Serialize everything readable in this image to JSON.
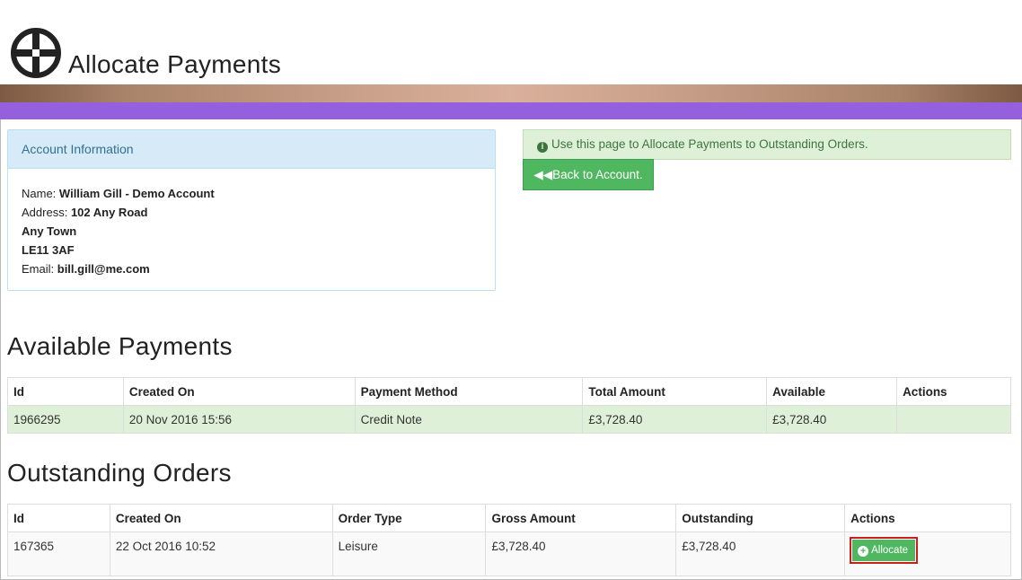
{
  "page": {
    "title": "Allocate Payments"
  },
  "account": {
    "header": "Account Information",
    "name_label": "Name:",
    "name": "William Gill - Demo Account",
    "address_label": "Address:",
    "address_line1": "102 Any Road",
    "address_line2": "Any Town",
    "address_line3": "LE11 3AF",
    "email_label": "Email:",
    "email": "bill.gill@me.com"
  },
  "alert": {
    "text": "Use this page to Allocate Payments to Outstanding Orders."
  },
  "back_button": {
    "label": "Back to Account."
  },
  "available_payments": {
    "heading": "Available Payments",
    "columns": [
      "Id",
      "Created On",
      "Payment Method",
      "Total Amount",
      "Available",
      "Actions"
    ],
    "rows": [
      {
        "id": "1966295",
        "created_on": "20 Nov 2016 15:56",
        "method": "Credit Note",
        "total": "£3,728.40",
        "available": "£3,728.40",
        "actions": ""
      }
    ]
  },
  "outstanding_orders": {
    "heading": "Outstanding Orders",
    "columns": [
      "Id",
      "Created On",
      "Order Type",
      "Gross Amount",
      "Outstanding",
      "Actions"
    ],
    "rows": [
      {
        "id": "167365",
        "created_on": "22 Oct 2016 10:52",
        "order_type": "Leisure",
        "gross": "£3,728.40",
        "outstanding": "£3,728.40",
        "action_label": "Allocate"
      }
    ]
  },
  "colors": {
    "brand_purple": "#9460dd",
    "success_green": "#4fb760",
    "highlight_red": "#c71e1e",
    "info_blue": "#31708f"
  },
  "icons": {
    "logo": "crosshair-logo-icon",
    "alert": "info-circle-icon",
    "back": "double-chevron-left-icon",
    "allocate": "plus-circle-icon"
  }
}
